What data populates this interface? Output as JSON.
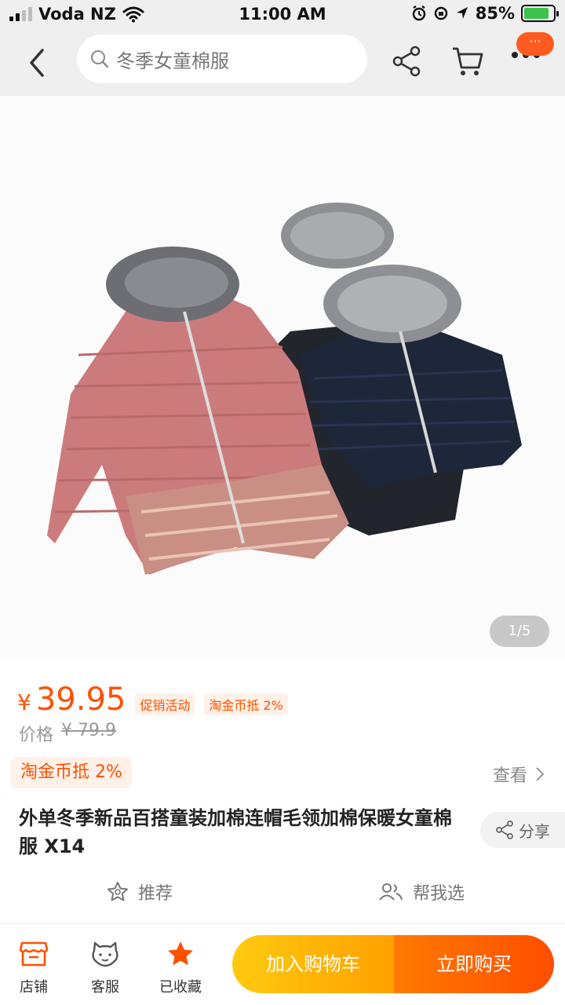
{
  "status_bar": {
    "carrier": "Voda NZ",
    "time": "11:00 AM",
    "battery_percent": "85%",
    "battery_level": 0.85
  },
  "nav": {
    "search_placeholder": "冬季女童棉服",
    "more_badge": "···"
  },
  "gallery": {
    "counter": "1/5"
  },
  "price": {
    "currency": "¥",
    "value": "39.95",
    "tags": [
      "促销活动",
      "淘金币抵 2%"
    ],
    "original_label": "价格",
    "original_value": "¥ 79.9"
  },
  "coupon": {
    "label": "淘金币抵 2%",
    "view_label": "查看"
  },
  "product": {
    "title": "外单冬季新品百搭童装加棉连帽毛领加棉保暖女童棉服 X14",
    "share_label": "分享"
  },
  "actions": {
    "recommend_label": "推荐",
    "help_choose_label": "帮我选"
  },
  "bottom_bar": {
    "store_label": "店铺",
    "service_label": "客服",
    "favorite_label": "已收藏",
    "add_cart_label": "加入购物车",
    "buy_now_label": "立即购买"
  },
  "colors": {
    "accent": "#ff5000",
    "cart_button": "#ffb000",
    "buy_button": "#ff5a00"
  }
}
